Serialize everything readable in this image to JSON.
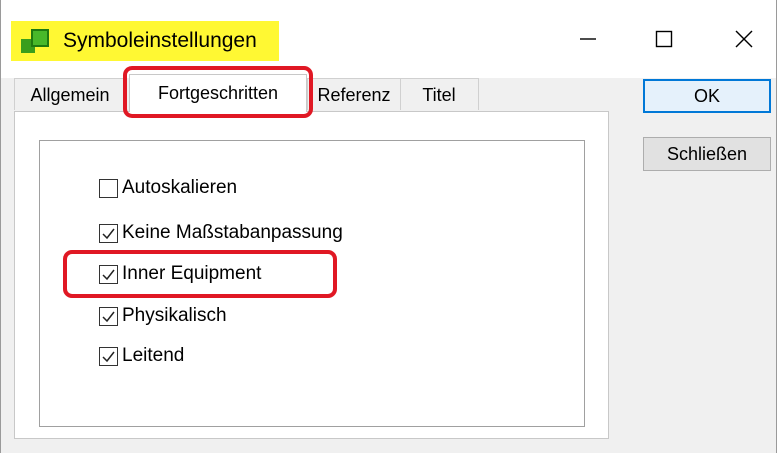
{
  "window": {
    "title": "Symboleinstellungen",
    "minimize_icon": "minimize-icon",
    "maximize_icon": "maximize-icon",
    "close_icon": "close-icon"
  },
  "tabs": [
    {
      "label": "Allgemein",
      "active": false
    },
    {
      "label": "Fortgeschritten",
      "active": true
    },
    {
      "label": "Referenz",
      "active": false
    },
    {
      "label": "Titel",
      "active": false
    }
  ],
  "checkboxes": [
    {
      "label": "Autoskalieren",
      "checked": false
    },
    {
      "label": "Keine Maßstabanpassung",
      "checked": true
    },
    {
      "label": "Inner Equipment",
      "checked": true
    },
    {
      "label": "Physikalisch",
      "checked": true
    },
    {
      "label": "Leitend",
      "checked": true
    }
  ],
  "buttons": {
    "ok": "OK",
    "close": "Schließen"
  },
  "colors": {
    "title_highlight": "#fff833",
    "annotation_red": "#e01824",
    "app_icon_green": "#3a9e1c"
  }
}
